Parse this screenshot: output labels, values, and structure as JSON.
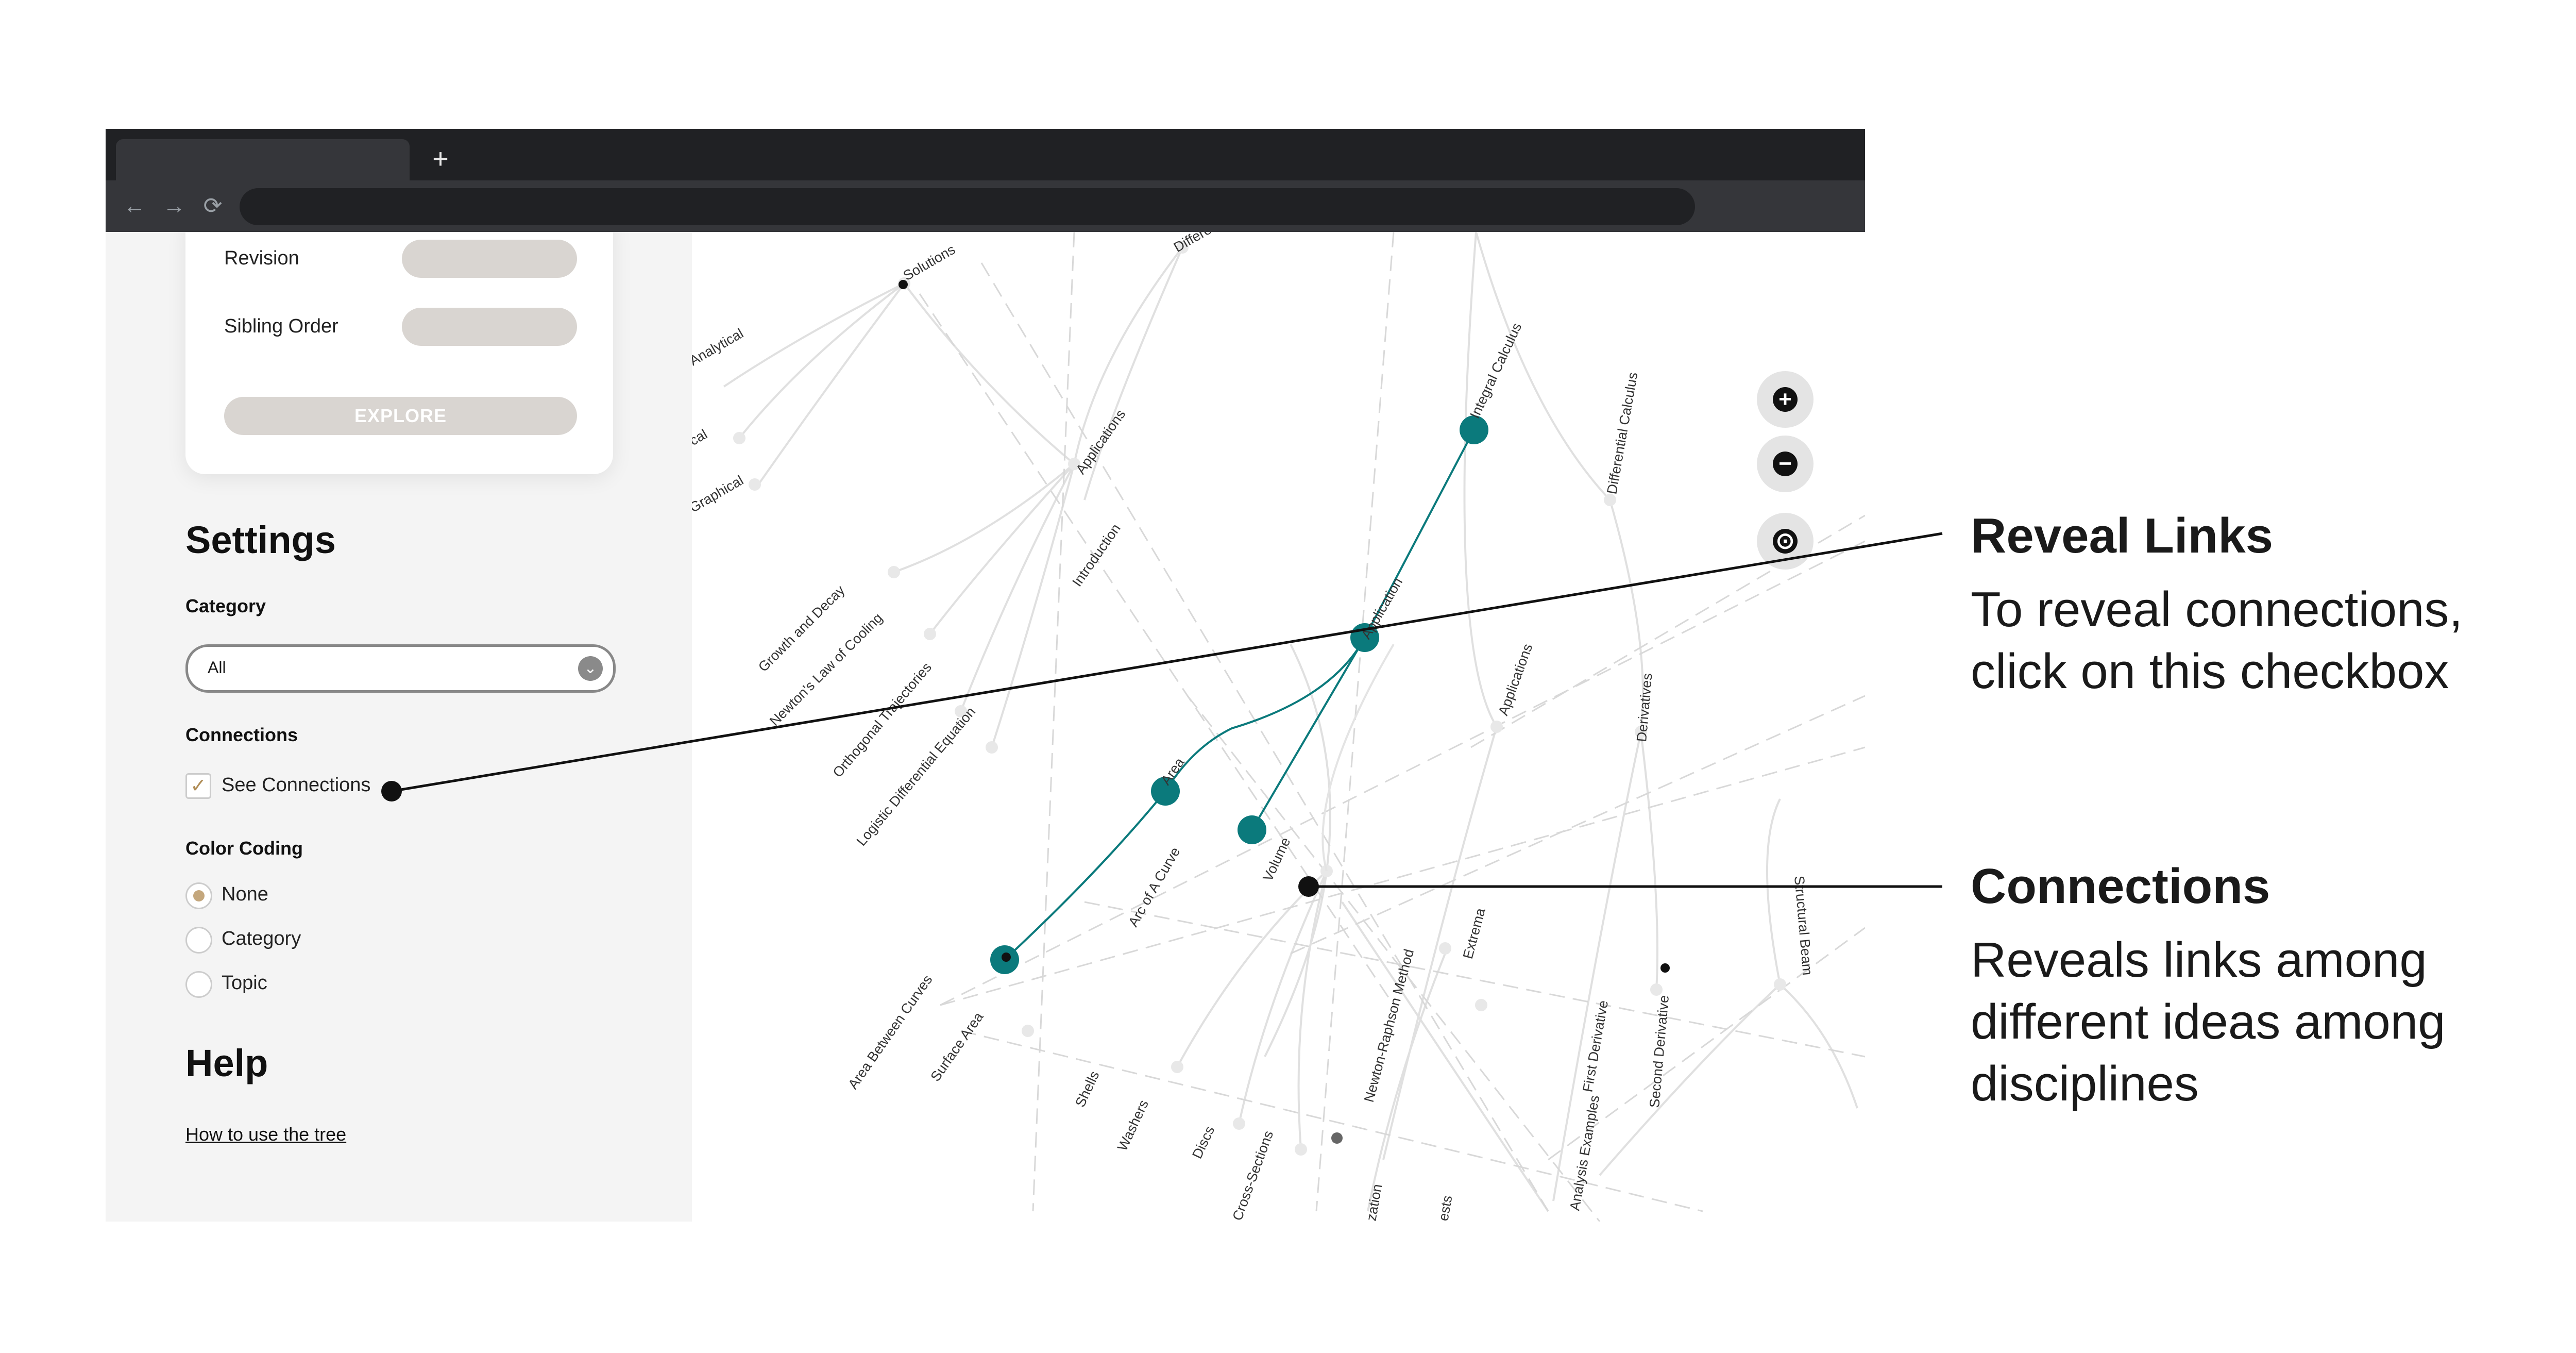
{
  "browser": {
    "new_tab_symbol": "+",
    "back_symbol": "←",
    "forward_symbol": "→",
    "reload_symbol": "⟳"
  },
  "card": {
    "revision_label": "Revision",
    "sibling_order_label": "Sibling Order",
    "explore_button": "EXPLORE"
  },
  "settings": {
    "title": "Settings",
    "category_label": "Category",
    "category_value": "All",
    "connections_label": "Connections",
    "see_connections_label": "See Connections",
    "see_connections_checked": true,
    "color_coding_label": "Color Coding",
    "color_options": [
      "None",
      "Category",
      "Topic"
    ],
    "color_selected": "None"
  },
  "help": {
    "title": "Help",
    "link": "How to use the tree"
  },
  "graph": {
    "highlight_color": "#0b7a7c",
    "node_labels": {
      "solutions": "Solutions",
      "differential_top": "Differe",
      "analytical": "Analytical",
      "cal": "cal",
      "graphical": "Graphical",
      "applications_left": "Applications",
      "integral_calculus": "Integral Calculus",
      "introduction": "Introduction",
      "growth_decay": "Growth and Decay",
      "newtons_cooling": "Newton's Law of Cooling",
      "orthogonal": "Orthogonal Trajectories",
      "logistic": "Logistic Differential Equation",
      "application": "Application",
      "area": "Area",
      "arc_curve": "Arc of A Curve",
      "volume": "Volume",
      "area_between": "Area Between Curves",
      "surface_area": "Surface Area",
      "shells": "Shells",
      "washers": "Washers",
      "discs": "Discs",
      "cross_sections": "Cross-Sections",
      "newton_raphson": "Newton-Raphson Method",
      "extrema": "Extrema",
      "ization": "zation",
      "ests": "ests",
      "differential_calculus": "Differential Calculus",
      "applications_right": "Applications",
      "derivatives": "Derivatives",
      "analysis_examples": "Analysis Examples",
      "first_derivative": "First Derivative",
      "second_derivative": "Second Derivative",
      "structural_beam": "Structural Beam"
    },
    "controls": {
      "zoom_in": "+",
      "zoom_out": "−",
      "recenter": "⊙"
    }
  },
  "annotations": {
    "reveal_title": "Reveal Links",
    "reveal_text": "To reveal connections, click on this checkbox",
    "connections_title": "Connections",
    "connections_text": "Reveals links among different ideas among disciplines"
  }
}
